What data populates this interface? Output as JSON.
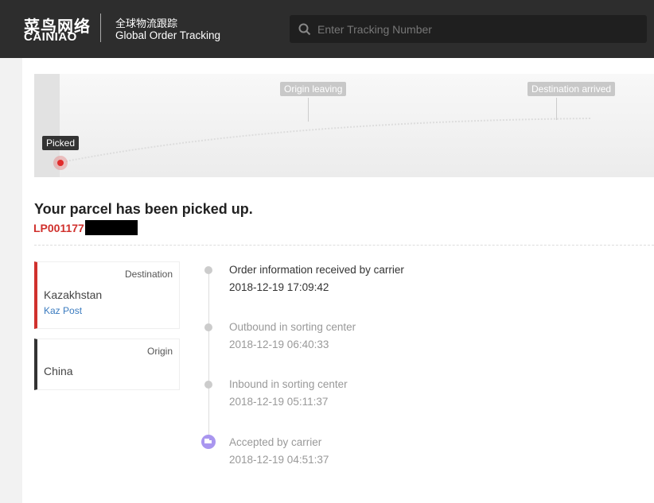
{
  "header": {
    "logo_cn": "菜鸟网络",
    "logo_en": "CAINIAO",
    "subtitle_cn": "全球物流跟踪",
    "subtitle_en": "Global Order Tracking",
    "search_placeholder": "Enter Tracking Number"
  },
  "map": {
    "stages": [
      "Picked",
      "Origin leaving",
      "Destination arrived"
    ]
  },
  "status": {
    "title": "Your parcel has been picked up.",
    "tracking_prefix": "LP001177"
  },
  "destination": {
    "label": "Destination",
    "country": "Kazakhstan",
    "carrier": "Kaz Post"
  },
  "origin": {
    "label": "Origin",
    "country": "China"
  },
  "events": [
    {
      "title": "Order information received by carrier",
      "time": "2018-12-19 17:09:42"
    },
    {
      "title": "Outbound in sorting center",
      "time": "2018-12-19 06:40:33"
    },
    {
      "title": "Inbound in sorting center",
      "time": "2018-12-19 05:11:37"
    },
    {
      "title": "Accepted by carrier",
      "time": "2018-12-19 04:51:37"
    }
  ],
  "colors": {
    "accent": "#d0312d",
    "header": "#2d2d2d",
    "link": "#3a7bbf",
    "carrier_icon": "#a996ef"
  }
}
